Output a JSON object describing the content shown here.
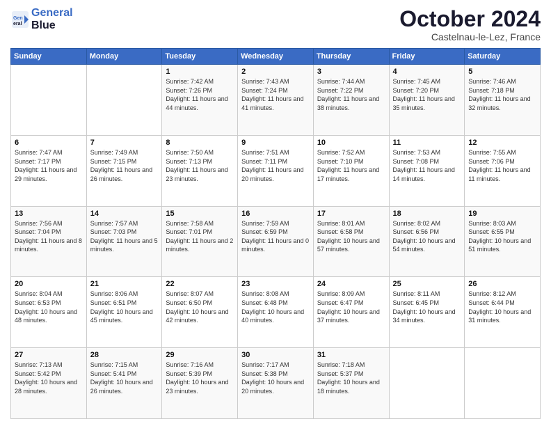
{
  "header": {
    "logo_line1": "General",
    "logo_line2": "Blue",
    "month": "October 2024",
    "location": "Castelnau-le-Lez, France"
  },
  "days_of_week": [
    "Sunday",
    "Monday",
    "Tuesday",
    "Wednesday",
    "Thursday",
    "Friday",
    "Saturday"
  ],
  "weeks": [
    [
      {
        "day": "",
        "content": ""
      },
      {
        "day": "",
        "content": ""
      },
      {
        "day": "1",
        "content": "Sunrise: 7:42 AM\nSunset: 7:26 PM\nDaylight: 11 hours and 44 minutes."
      },
      {
        "day": "2",
        "content": "Sunrise: 7:43 AM\nSunset: 7:24 PM\nDaylight: 11 hours and 41 minutes."
      },
      {
        "day": "3",
        "content": "Sunrise: 7:44 AM\nSunset: 7:22 PM\nDaylight: 11 hours and 38 minutes."
      },
      {
        "day": "4",
        "content": "Sunrise: 7:45 AM\nSunset: 7:20 PM\nDaylight: 11 hours and 35 minutes."
      },
      {
        "day": "5",
        "content": "Sunrise: 7:46 AM\nSunset: 7:18 PM\nDaylight: 11 hours and 32 minutes."
      }
    ],
    [
      {
        "day": "6",
        "content": "Sunrise: 7:47 AM\nSunset: 7:17 PM\nDaylight: 11 hours and 29 minutes."
      },
      {
        "day": "7",
        "content": "Sunrise: 7:49 AM\nSunset: 7:15 PM\nDaylight: 11 hours and 26 minutes."
      },
      {
        "day": "8",
        "content": "Sunrise: 7:50 AM\nSunset: 7:13 PM\nDaylight: 11 hours and 23 minutes."
      },
      {
        "day": "9",
        "content": "Sunrise: 7:51 AM\nSunset: 7:11 PM\nDaylight: 11 hours and 20 minutes."
      },
      {
        "day": "10",
        "content": "Sunrise: 7:52 AM\nSunset: 7:10 PM\nDaylight: 11 hours and 17 minutes."
      },
      {
        "day": "11",
        "content": "Sunrise: 7:53 AM\nSunset: 7:08 PM\nDaylight: 11 hours and 14 minutes."
      },
      {
        "day": "12",
        "content": "Sunrise: 7:55 AM\nSunset: 7:06 PM\nDaylight: 11 hours and 11 minutes."
      }
    ],
    [
      {
        "day": "13",
        "content": "Sunrise: 7:56 AM\nSunset: 7:04 PM\nDaylight: 11 hours and 8 minutes."
      },
      {
        "day": "14",
        "content": "Sunrise: 7:57 AM\nSunset: 7:03 PM\nDaylight: 11 hours and 5 minutes."
      },
      {
        "day": "15",
        "content": "Sunrise: 7:58 AM\nSunset: 7:01 PM\nDaylight: 11 hours and 2 minutes."
      },
      {
        "day": "16",
        "content": "Sunrise: 7:59 AM\nSunset: 6:59 PM\nDaylight: 11 hours and 0 minutes."
      },
      {
        "day": "17",
        "content": "Sunrise: 8:01 AM\nSunset: 6:58 PM\nDaylight: 10 hours and 57 minutes."
      },
      {
        "day": "18",
        "content": "Sunrise: 8:02 AM\nSunset: 6:56 PM\nDaylight: 10 hours and 54 minutes."
      },
      {
        "day": "19",
        "content": "Sunrise: 8:03 AM\nSunset: 6:55 PM\nDaylight: 10 hours and 51 minutes."
      }
    ],
    [
      {
        "day": "20",
        "content": "Sunrise: 8:04 AM\nSunset: 6:53 PM\nDaylight: 10 hours and 48 minutes."
      },
      {
        "day": "21",
        "content": "Sunrise: 8:06 AM\nSunset: 6:51 PM\nDaylight: 10 hours and 45 minutes."
      },
      {
        "day": "22",
        "content": "Sunrise: 8:07 AM\nSunset: 6:50 PM\nDaylight: 10 hours and 42 minutes."
      },
      {
        "day": "23",
        "content": "Sunrise: 8:08 AM\nSunset: 6:48 PM\nDaylight: 10 hours and 40 minutes."
      },
      {
        "day": "24",
        "content": "Sunrise: 8:09 AM\nSunset: 6:47 PM\nDaylight: 10 hours and 37 minutes."
      },
      {
        "day": "25",
        "content": "Sunrise: 8:11 AM\nSunset: 6:45 PM\nDaylight: 10 hours and 34 minutes."
      },
      {
        "day": "26",
        "content": "Sunrise: 8:12 AM\nSunset: 6:44 PM\nDaylight: 10 hours and 31 minutes."
      }
    ],
    [
      {
        "day": "27",
        "content": "Sunrise: 7:13 AM\nSunset: 5:42 PM\nDaylight: 10 hours and 28 minutes."
      },
      {
        "day": "28",
        "content": "Sunrise: 7:15 AM\nSunset: 5:41 PM\nDaylight: 10 hours and 26 minutes."
      },
      {
        "day": "29",
        "content": "Sunrise: 7:16 AM\nSunset: 5:39 PM\nDaylight: 10 hours and 23 minutes."
      },
      {
        "day": "30",
        "content": "Sunrise: 7:17 AM\nSunset: 5:38 PM\nDaylight: 10 hours and 20 minutes."
      },
      {
        "day": "31",
        "content": "Sunrise: 7:18 AM\nSunset: 5:37 PM\nDaylight: 10 hours and 18 minutes."
      },
      {
        "day": "",
        "content": ""
      },
      {
        "day": "",
        "content": ""
      }
    ]
  ]
}
